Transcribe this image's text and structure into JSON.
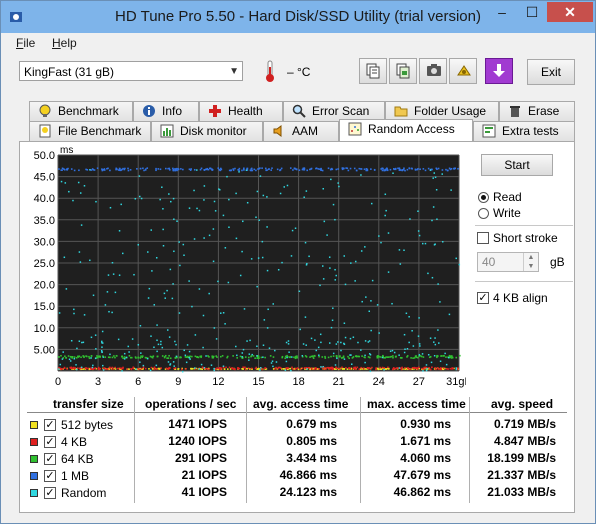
{
  "window": {
    "title": "HD Tune Pro 5.50 - Hard Disk/SSD Utility (trial version)",
    "minimize": "–",
    "maximize": "☐",
    "close": "✕"
  },
  "menu": [
    {
      "label": "File",
      "key": "F"
    },
    {
      "label": "Help",
      "key": "H"
    }
  ],
  "toolbar": {
    "drive": "KingFast (31 gB)",
    "temperature": "– °C",
    "exit_label": "Exit",
    "buttons": [
      {
        "icon": "copy-text-icon"
      },
      {
        "icon": "copy-screenshot-icon"
      },
      {
        "icon": "camera-icon"
      },
      {
        "icon": "options-icon"
      },
      {
        "icon": "save-download-icon"
      }
    ]
  },
  "tabs_row1": [
    {
      "label": "Benchmark",
      "icon": "lightbulb-icon"
    },
    {
      "label": "Info",
      "icon": "info-icon"
    },
    {
      "label": "Health",
      "icon": "health-cross-icon"
    },
    {
      "label": "Error Scan",
      "icon": "magnifier-icon"
    },
    {
      "label": "Folder Usage",
      "icon": "folder-icon"
    },
    {
      "label": "Erase",
      "icon": "trash-icon"
    }
  ],
  "tabs_row2": [
    {
      "label": "File Benchmark",
      "icon": "file-bulb-icon"
    },
    {
      "label": "Disk monitor",
      "icon": "monitor-chart-icon"
    },
    {
      "label": "AAM",
      "icon": "speaker-icon"
    },
    {
      "label": "Random Access",
      "icon": "random-dots-icon",
      "active": true
    },
    {
      "label": "Extra tests",
      "icon": "extra-tests-icon"
    }
  ],
  "controls": {
    "start_label": "Start",
    "read_label": "Read",
    "read_selected": true,
    "write_label": "Write",
    "write_selected": false,
    "short_stroke_label": "Short stroke",
    "short_stroke_checked": false,
    "short_stroke_value": "40",
    "short_stroke_unit": "gB",
    "align_label": "4 KB align",
    "align_checked": true
  },
  "chart_data": {
    "type": "scatter",
    "ylabel": "ms",
    "y_ticks": [
      "50.0",
      "45.0",
      "40.0",
      "35.0",
      "30.0",
      "25.0",
      "20.0",
      "15.0",
      "10.0",
      "5.00"
    ],
    "x_ticks": [
      "0",
      "3",
      "6",
      "9",
      "12",
      "15",
      "18",
      "21",
      "24",
      "27",
      "31gB"
    ],
    "xlim": [
      0,
      31
    ],
    "ylim": [
      0,
      50
    ],
    "grid": true,
    "background": "#1f1f1f",
    "series": [
      {
        "name": "512 bytes",
        "color": "#f0e020",
        "level": 0.679,
        "spread": 0.2
      },
      {
        "name": "4 KB",
        "color": "#e02020",
        "level": 0.805,
        "spread": 0.5
      },
      {
        "name": "64 KB",
        "color": "#30c030",
        "level": 3.434,
        "spread": 0.6
      },
      {
        "name": "1 MB",
        "color": "#3070e0",
        "level": 46.866,
        "spread": 0.6
      },
      {
        "name": "Random",
        "color": "#30d8e0",
        "level": 24.123,
        "spread": 23
      }
    ]
  },
  "results": {
    "headers": [
      "transfer size",
      "operations / sec",
      "avg. access time",
      "max. access time",
      "avg. speed"
    ],
    "rows": [
      {
        "label": "512 bytes",
        "color": "#f0e020",
        "ops": "1471 IOPS",
        "avg": "0.679 ms",
        "max": "0.930 ms",
        "speed": "0.719 MB/s"
      },
      {
        "label": "4 KB",
        "color": "#e02020",
        "ops": "1240 IOPS",
        "avg": "0.805 ms",
        "max": "1.671 ms",
        "speed": "4.847 MB/s"
      },
      {
        "label": "64 KB",
        "color": "#30c030",
        "ops": "291 IOPS",
        "avg": "3.434 ms",
        "max": "4.060 ms",
        "speed": "18.199 MB/s"
      },
      {
        "label": "1 MB",
        "color": "#3070e0",
        "ops": "21 IOPS",
        "avg": "46.866 ms",
        "max": "47.679 ms",
        "speed": "21.337 MB/s"
      },
      {
        "label": "Random",
        "color": "#30d8e0",
        "ops": "41 IOPS",
        "avg": "24.123 ms",
        "max": "46.862 ms",
        "speed": "21.033 MB/s"
      }
    ]
  }
}
